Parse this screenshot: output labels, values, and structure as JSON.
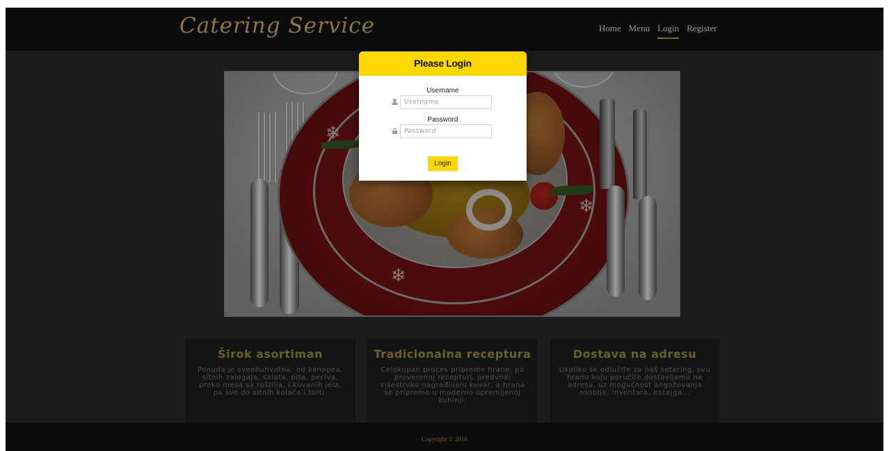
{
  "header": {
    "logo": "Catering Service",
    "nav": [
      {
        "label": "Home",
        "active": false
      },
      {
        "label": "Menu",
        "active": false
      },
      {
        "label": "Login",
        "active": true
      },
      {
        "label": "Register",
        "active": false
      }
    ]
  },
  "modal": {
    "title": "Please Login",
    "close_glyph": "×",
    "username": {
      "label": "Username",
      "placeholder": "Username",
      "icon": "user-icon"
    },
    "password": {
      "label": "Password",
      "placeholder": "Password",
      "icon": "lock-icon"
    },
    "login_label": "Login",
    "accent_color": "#ffd700"
  },
  "features": [
    {
      "title": "Širok asortiman",
      "text": "Ponuda je sveobuhvatna: od kanapea, sitnih zalogaja, salata, pita, peciva, preko mesa sa roštilja, i kuvanih jela, pa sve do sitnih kolača i torti."
    },
    {
      "title": "Tradicionalna receptura",
      "text": "Celokupan proces pripreme hrane, po proverenoj recepturi, predvodi višestruko nagrađivani kuvar, a hrana se priprema u moderno opremljenoj kuhinji."
    },
    {
      "title": "Dostava na adresu",
      "text": "Ukoliko se odlučite za naš ketering, svu hranu koju poručite dostavljamo na adresu, uz mogućnost angažovanja osoblje, inventara, escajga..."
    }
  ],
  "footer": {
    "copyright": "Copyright © 2016"
  },
  "colors": {
    "overlay_background": "#1c1c1c",
    "gold_text": "#6e5f28",
    "accent": "#ffd700"
  }
}
